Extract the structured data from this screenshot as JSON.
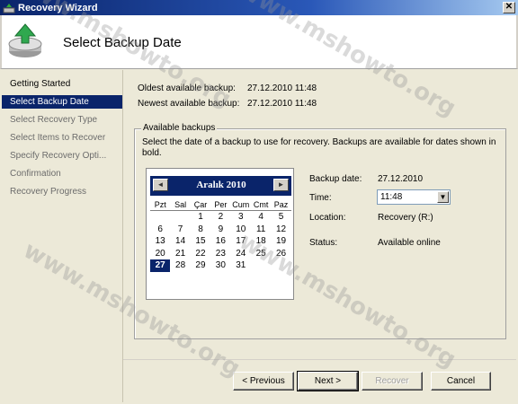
{
  "window": {
    "title": "Recovery Wizard",
    "close_label": "✕"
  },
  "header": {
    "title": "Select Backup Date"
  },
  "nav": [
    {
      "label": "Getting Started",
      "state": "done"
    },
    {
      "label": "Select Backup Date",
      "state": "active"
    },
    {
      "label": "Select Recovery Type",
      "state": "pending"
    },
    {
      "label": "Select Items to Recover",
      "state": "pending"
    },
    {
      "label": "Specify Recovery Opti...",
      "state": "pending"
    },
    {
      "label": "Confirmation",
      "state": "pending"
    },
    {
      "label": "Recovery Progress",
      "state": "pending"
    }
  ],
  "backup_info": {
    "oldest_label": "Oldest available backup:",
    "oldest_value": "27.12.2010 11:48",
    "newest_label": "Newest available backup:",
    "newest_value": "27.12.2010 11:48"
  },
  "available": {
    "title": "Available backups",
    "description": "Select the date of a backup to use for recovery. Backups are available for dates shown in bold."
  },
  "calendar": {
    "month": "Aralık 2010",
    "prev_icon": "◄",
    "next_icon": "►",
    "days_of_week": [
      "Pzt",
      "Sal",
      "Çar",
      "Per",
      "Cum",
      "Cmt",
      "Paz"
    ],
    "weeks": [
      [
        "",
        "",
        "1",
        "2",
        "3",
        "4",
        "5"
      ],
      [
        "6",
        "7",
        "8",
        "9",
        "10",
        "11",
        "12"
      ],
      [
        "13",
        "14",
        "15",
        "16",
        "17",
        "18",
        "19"
      ],
      [
        "20",
        "21",
        "22",
        "23",
        "24",
        "25",
        "26"
      ],
      [
        "27",
        "28",
        "29",
        "30",
        "31",
        "",
        ""
      ]
    ],
    "selected": "27"
  },
  "details": {
    "date_label": "Backup date:",
    "date_value": "27.12.2010",
    "time_label": "Time:",
    "time_value": "11:48",
    "location_label": "Location:",
    "location_value": "Recovery (R:)",
    "status_label": "Status:",
    "status_value": "Available online"
  },
  "buttons": {
    "previous": "< Previous",
    "next": "Next >",
    "recover": "Recover",
    "cancel": "Cancel"
  },
  "watermark": "www.mshowto.org"
}
